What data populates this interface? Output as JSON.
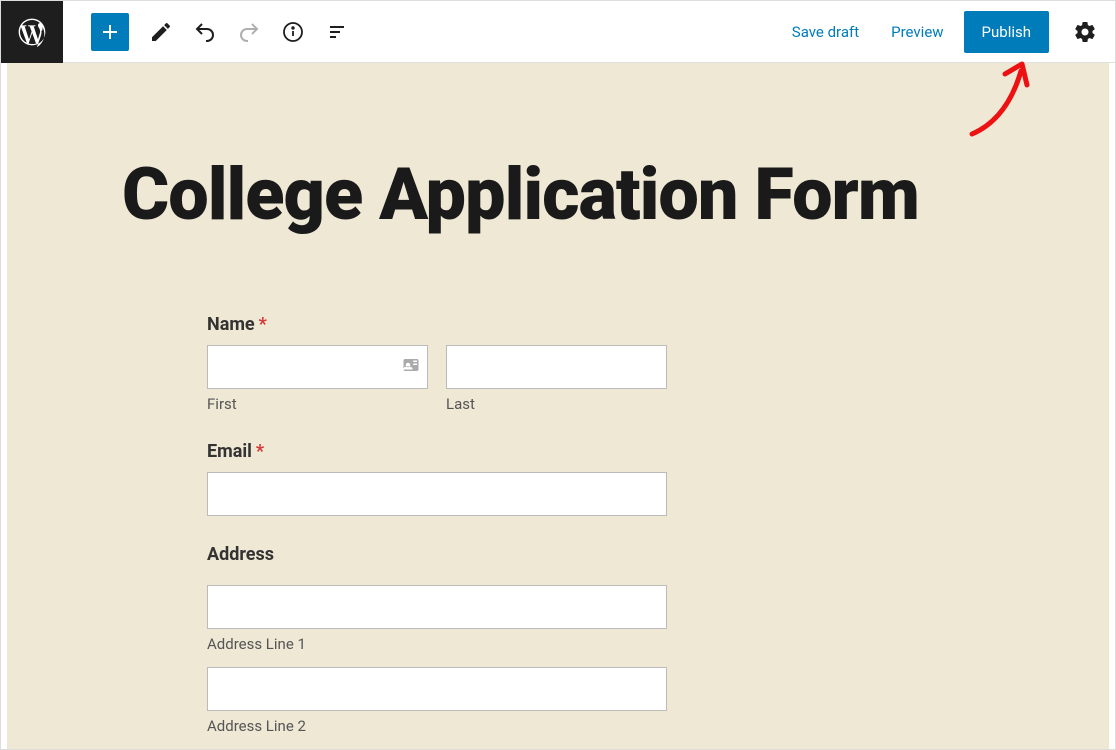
{
  "toolbar": {
    "save_draft": "Save draft",
    "preview": "Preview",
    "publish": "Publish"
  },
  "page": {
    "title": "College Application Form"
  },
  "form": {
    "name": {
      "label": "Name",
      "required": "*",
      "first_label": "First",
      "last_label": "Last"
    },
    "email": {
      "label": "Email",
      "required": "*"
    },
    "address": {
      "label": "Address",
      "line1_label": "Address Line 1",
      "line2_label": "Address Line 2"
    }
  },
  "colors": {
    "accent": "#007cba"
  }
}
